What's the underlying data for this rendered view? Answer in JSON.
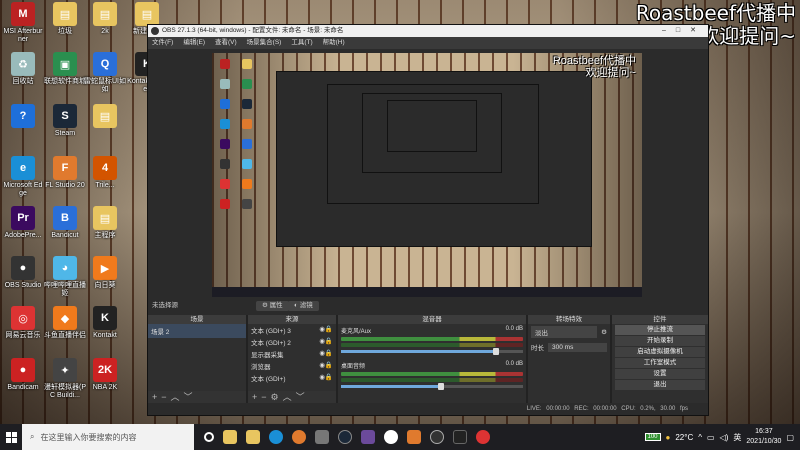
{
  "overlay": {
    "line1": "Roastbeef代播中",
    "line2": "欢迎提问~"
  },
  "desktop_icons": [
    {
      "label": "MSI Afterburner",
      "color": "#b22",
      "glyph": "M"
    },
    {
      "label": "回收站",
      "color": "#9bb",
      "glyph": "♻"
    },
    {
      "label": "",
      "color": "#1e6fd9",
      "glyph": "?"
    },
    {
      "label": "Microsoft Edge",
      "color": "#1a8fd6",
      "glyph": "e"
    },
    {
      "label": "AdobePre...",
      "color": "#3b0a5f",
      "glyph": "Pr"
    },
    {
      "label": "OBS Studio",
      "color": "#333",
      "glyph": "●"
    },
    {
      "label": "网易云音乐",
      "color": "#d33",
      "glyph": "◎"
    },
    {
      "label": "Bandicam",
      "color": "#c22",
      "glyph": "●"
    },
    {
      "label": "垃圾",
      "color": "#e8c560",
      "glyph": "▤"
    },
    {
      "label": "联想软件商城",
      "color": "#2a8f4f",
      "glyph": "▣"
    },
    {
      "label": "Steam",
      "color": "#1b2838",
      "glyph": "S"
    },
    {
      "label": "FL Studio 20",
      "color": "#e07a2e",
      "glyph": "F"
    },
    {
      "label": "Bandicut",
      "color": "#2a6fd9",
      "glyph": "B"
    },
    {
      "label": "哔哩哔哩直播姬",
      "color": "#4fb7e8",
      "glyph": "◕"
    },
    {
      "label": "斗鱼直播伴侣",
      "color": "#f07a1c",
      "glyph": "◆"
    },
    {
      "label": "漫轩模拟器(PC Buildi...",
      "color": "#444",
      "glyph": "✦"
    },
    {
      "label": "2k",
      "color": "#e8c560",
      "glyph": "▤"
    },
    {
      "label": "雷蛇鼠标UI如如",
      "color": "#2a6fd9",
      "glyph": "Q"
    },
    {
      "label": "",
      "color": "#e8c560",
      "glyph": "▤"
    },
    {
      "label": "Trile...",
      "color": "#d35400",
      "glyph": "4"
    },
    {
      "label": "主程序",
      "color": "#e8c560",
      "glyph": "▤"
    },
    {
      "label": "向日葵",
      "color": "#f07a1c",
      "glyph": "▶"
    },
    {
      "label": "Kontakt",
      "color": "#222",
      "glyph": "K"
    },
    {
      "label": "NBA 2K",
      "color": "#c22",
      "glyph": "2K"
    },
    {
      "label": "新建文件",
      "color": "#e8c560",
      "glyph": "▤"
    },
    {
      "label": "Kontakt工具.ex",
      "color": "#222",
      "glyph": "K"
    }
  ],
  "obs": {
    "title": "OBS 27.1.3 (64-bit, windows) - 配置文件: 未命名 - 场景: 未命名",
    "menu": [
      "文件(F)",
      "编辑(E)",
      "查看(V)",
      "场景集合(S)",
      "工具(T)",
      "帮助(H)"
    ],
    "scene_bar": {
      "label": "未选择源",
      "properties": "属性",
      "filters": "滤镜"
    },
    "scenes": {
      "header": "场景",
      "items": [
        "场景 2"
      ]
    },
    "sources": {
      "header": "来源",
      "items": [
        "文本 (GDI+) 3",
        "文本 (GDI+) 2",
        "显示器采集",
        "浏览器",
        "文本 (GDI+)"
      ]
    },
    "mixer": {
      "header": "混音器",
      "channels": [
        {
          "name": "麦克风/Aux",
          "db": "0.0 dB",
          "level": 0.85
        },
        {
          "name": "桌面音频",
          "db": "0.0 dB",
          "level": 0.55
        }
      ]
    },
    "transitions": {
      "header": "转场特效",
      "type": "淡出",
      "duration_label": "时长",
      "duration": "300 ms"
    },
    "controls": {
      "header": "控件",
      "buttons": [
        "停止推流",
        "开始录制",
        "启动虚拟摄像机",
        "工作室模式",
        "设置",
        "退出"
      ]
    },
    "status": "LIVE: 00:00:00   REC: 00:00:00   CPU: 0.2%, 30.00 fps"
  },
  "taskbar": {
    "search_placeholder": "在这里输入你要搜索的内容",
    "temp": "22°C",
    "battery": "100",
    "lang": "英",
    "time": "16:37",
    "date": "2021/10/30"
  }
}
